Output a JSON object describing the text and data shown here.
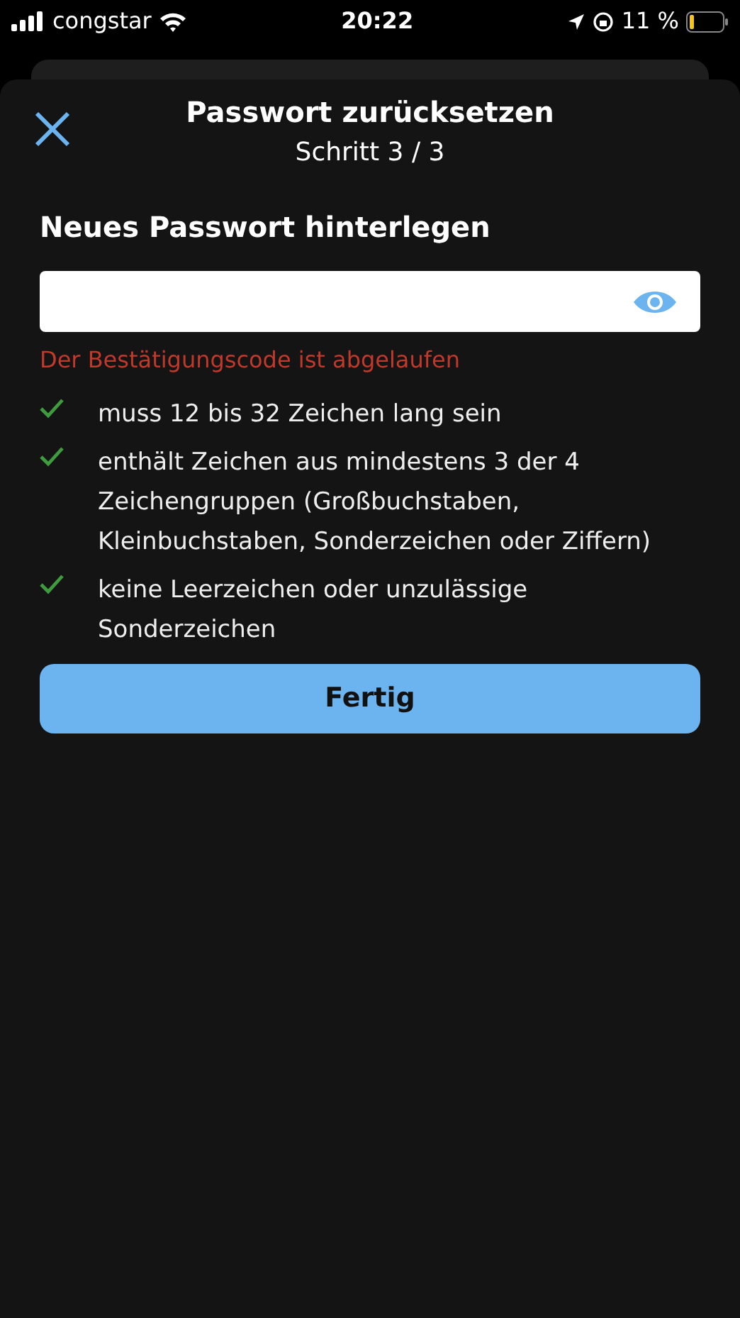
{
  "status_bar": {
    "carrier": "congstar",
    "time": "20:22",
    "battery": "11 %"
  },
  "header": {
    "title": "Passwort zurücksetzen",
    "subtitle": "Schritt 3 / 3"
  },
  "section_title": "Neues Passwort hinterlegen",
  "error": "Der Bestätigungscode ist abgelaufen",
  "rules": [
    {
      "text": "muss 12 bis 32 Zeichen lang sein",
      "met": true
    },
    {
      "text": "enthält Zeichen aus mindestens 3 der 4 Zeichengruppen (Großbuchstaben, Kleinbuchstaben, Sonderzeichen oder Ziffern)",
      "met": true
    },
    {
      "text": "keine Leerzeichen oder unzulässige Sonderzeichen",
      "met": true
    }
  ],
  "submit_button": "Fertig"
}
